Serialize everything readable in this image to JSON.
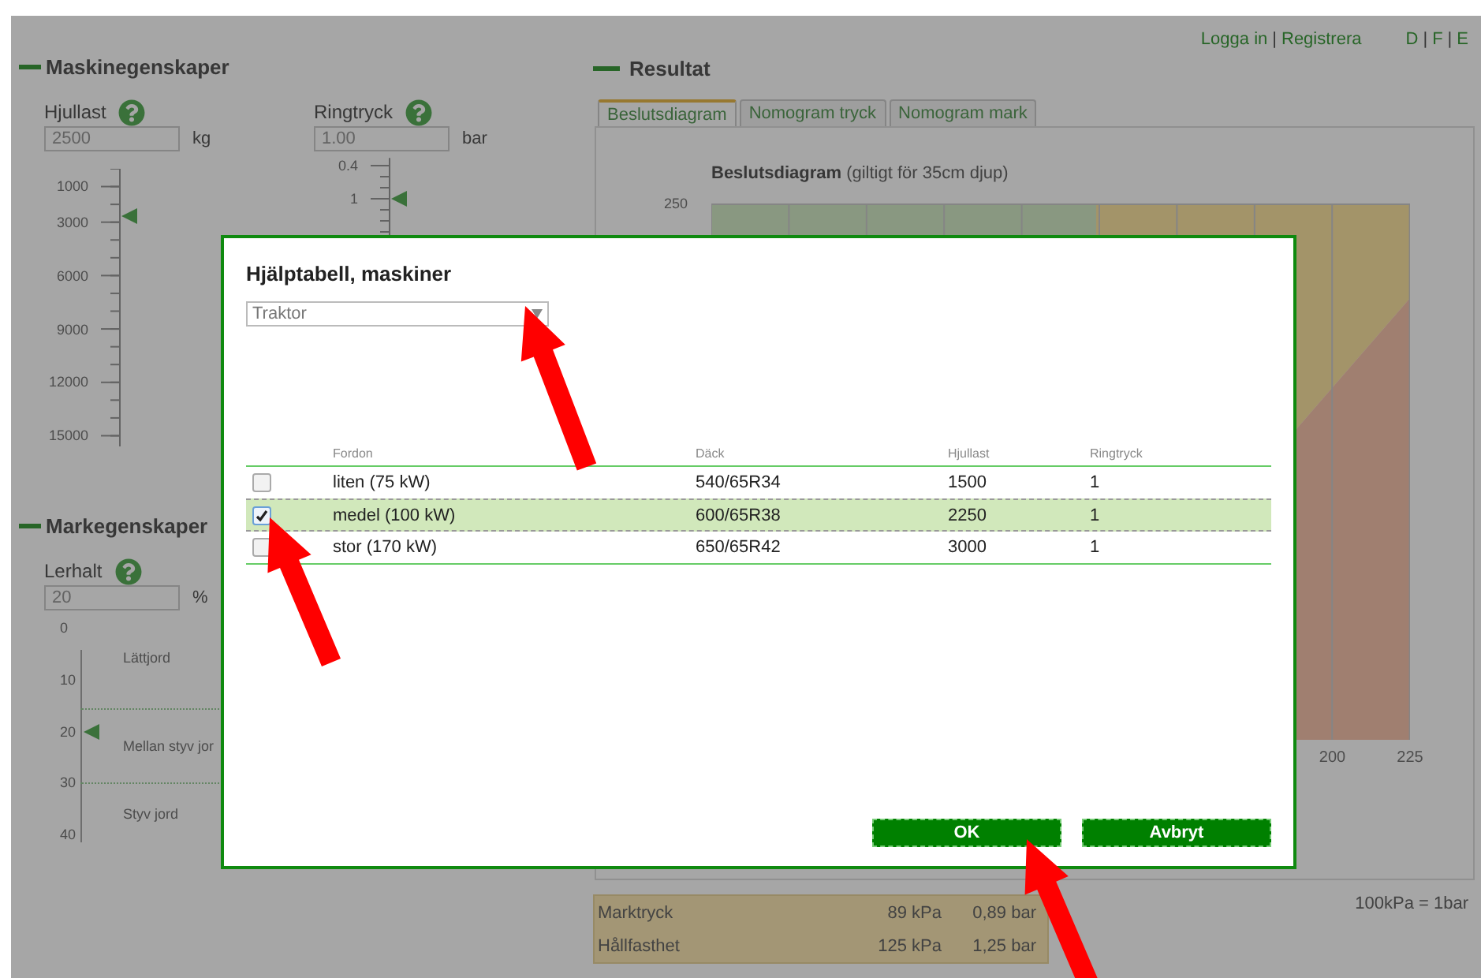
{
  "top_links": {
    "login": "Logga in",
    "separator": "|",
    "register": "Registrera",
    "languages": [
      "D",
      "F",
      "E"
    ]
  },
  "machine": {
    "title": "Maskinegenskaper",
    "fields": [
      {
        "label": "Hjullast",
        "value": "2500",
        "unit": "kg",
        "ticks": [
          "1000",
          "3000",
          "6000",
          "9000",
          "12000",
          "15000"
        ]
      },
      {
        "label": "Ringtryck",
        "value": "1.00",
        "unit": "bar",
        "ticks": [
          "0.4",
          "1"
        ]
      }
    ]
  },
  "soil": {
    "title": "Markegenskaper",
    "label": "Lerhalt",
    "value": "20",
    "unit": "%",
    "ticks": [
      "0",
      "10",
      "20",
      "30",
      "40"
    ],
    "zones": [
      "Lättjord",
      "Mellan styv jor",
      "Styv jord"
    ]
  },
  "results": {
    "title": "Resultat",
    "tabs": [
      {
        "label": "Beslutsdiagram",
        "selected": true
      },
      {
        "label": "Nomogram tryck",
        "selected": false
      },
      {
        "label": "Nomogram mark",
        "selected": false
      }
    ],
    "chart": {
      "title": "**Beslutsdiagram** (giltigt för 35cm djup)",
      "y_tick": "250",
      "x_ticks": [
        "200",
        "225"
      ]
    },
    "summary": [
      {
        "label": "Marktryck",
        "kpa": "89 kPa",
        "bar": "0,89 bar"
      },
      {
        "label": "Hållfasthet",
        "kpa": "125 kPa",
        "bar": "1,25 bar"
      }
    ],
    "unit_note": "100kPa = 1bar"
  },
  "dialog": {
    "title": "Hjälptabell, maskiner",
    "select": "Traktor",
    "columns": [
      "Fordon",
      "Däck",
      "Hjullast",
      "Ringtryck"
    ],
    "rows": [
      {
        "checked": false,
        "cells": [
          "liten (75 kW)",
          "540/65R34",
          "1500",
          "1"
        ]
      },
      {
        "checked": true,
        "cells": [
          "medel (100 kW)",
          "600/65R38",
          "2250",
          "1"
        ]
      },
      {
        "checked": false,
        "cells": [
          "stor (170 kW)",
          "650/65R42",
          "3000",
          "1"
        ]
      }
    ],
    "buttons": [
      "OK",
      "Avbryt"
    ]
  }
}
